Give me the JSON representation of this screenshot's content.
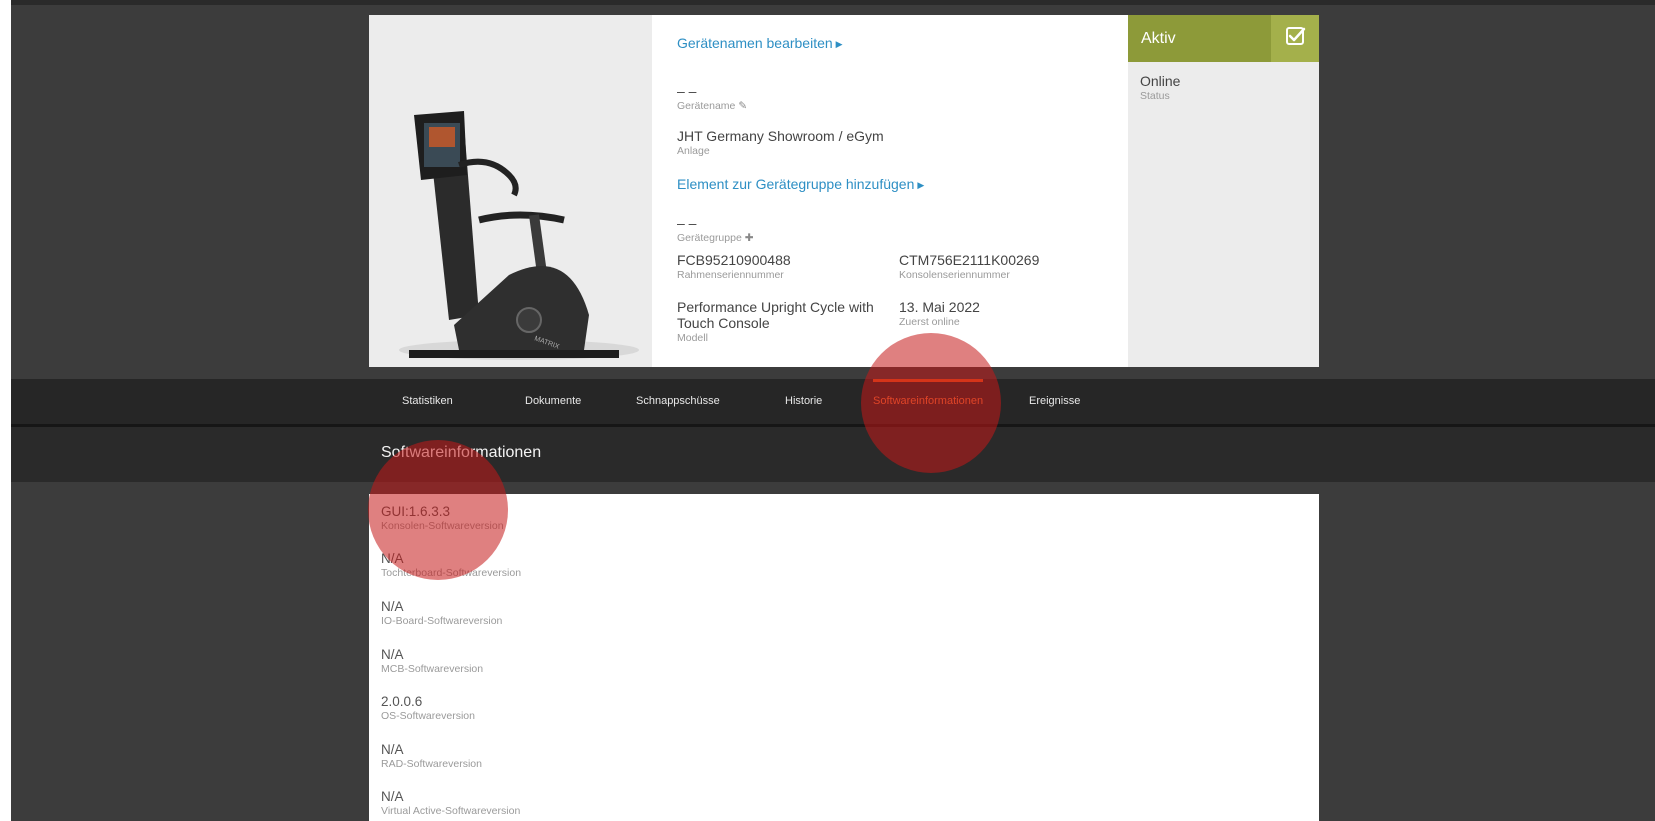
{
  "device": {
    "edit_name_link": "Gerätenamen bearbeiten",
    "name": {
      "value": "– –",
      "label": "Gerätename"
    },
    "facility": {
      "value": "JHT Germany Showroom / eGym",
      "label": "Anlage"
    },
    "add_group_link": "Element zur Gerätegruppe hinzufügen",
    "group": {
      "value": "– –",
      "label": "Gerätegruppe"
    },
    "frame_serial": {
      "value": "FCB95210900488",
      "label": "Rahmenseriennummer"
    },
    "console_serial": {
      "value": "CTM756E2111K00269",
      "label": "Konsolenseriennummer"
    },
    "model": {
      "value": "Performance Upright Cycle with Touch Console",
      "label": "Modell"
    },
    "first_online": {
      "value": "13. Mai 2022",
      "label": "Zuerst online"
    },
    "brand_text": "MATRIX"
  },
  "status": {
    "active_label": "Aktiv",
    "online": {
      "value": "Online",
      "label": "Status"
    }
  },
  "tabs": [
    {
      "label": "Statistiken"
    },
    {
      "label": "Dokumente"
    },
    {
      "label": "Schnappschüsse"
    },
    {
      "label": "Historie"
    },
    {
      "label": "Softwareinformationen",
      "active": true
    },
    {
      "label": "Ereignisse"
    }
  ],
  "section_title": "Softwareinformationen",
  "software": [
    {
      "value": "GUI:1.6.3.3",
      "label": "Konsolen-Softwareversion"
    },
    {
      "value": "N/A",
      "label": "Tochterboard-Softwareversion"
    },
    {
      "value": "N/A",
      "label": "IO-Board-Softwareversion"
    },
    {
      "value": "N/A",
      "label": "MCB-Softwareversion"
    },
    {
      "value": "2.0.0.6",
      "label": "OS-Softwareversion"
    },
    {
      "value": "N/A",
      "label": "RAD-Softwareversion"
    },
    {
      "value": "N/A",
      "label": "Virtual Active-Softwareversion"
    }
  ],
  "colors": {
    "accent_link": "#2e8fc4",
    "status_green": "#8d9a39",
    "active_tab": "#e8581c"
  }
}
